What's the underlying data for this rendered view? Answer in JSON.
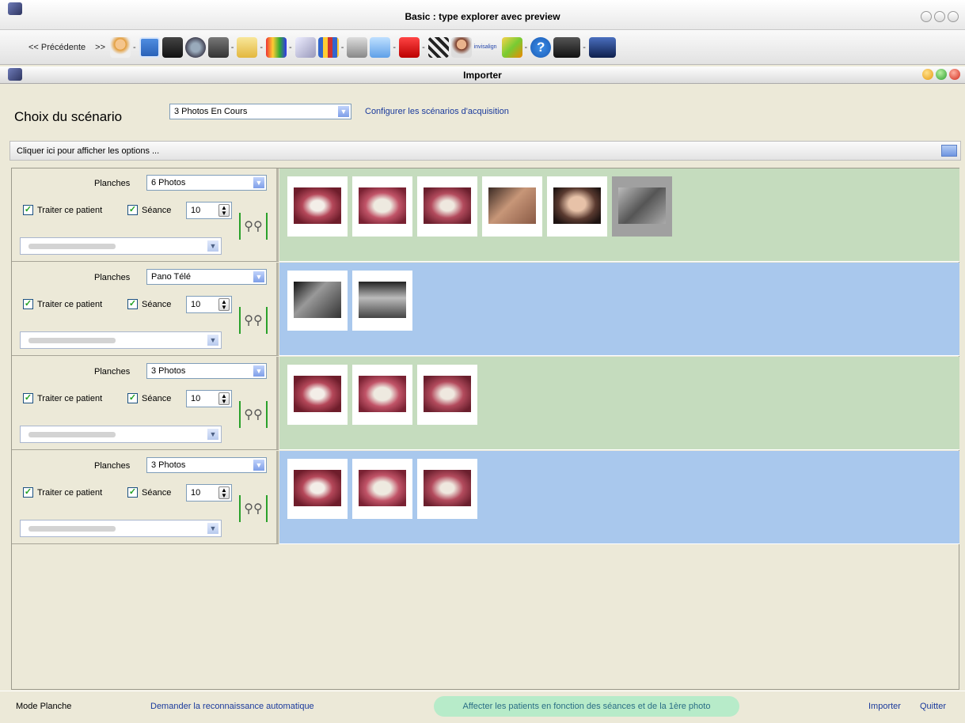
{
  "window": {
    "title": "Basic : type explorer avec preview"
  },
  "toolbar": {
    "prev_label": "<< Précédente",
    "more": ">>",
    "separator": "-",
    "icons": [
      "patient-icon",
      "window-icon",
      "scanner-icon",
      "camera-icon",
      "photo-camera-icon",
      "folder-icon",
      "paint-brushes-icon",
      "pencil-icon",
      "grid-icon",
      "printer-icon",
      "mail-icon",
      "presentation-icon",
      "clapperboard-icon",
      "person-icon",
      "invisalign-icon",
      "puzzle-icon",
      "help-icon",
      "dolphin-icon",
      "dolphin-blue-icon"
    ],
    "invisalign_text": "invisalign"
  },
  "subwindow": {
    "title": "Importer"
  },
  "scenario": {
    "label": "Choix du scénario",
    "selected": "3 Photos En Cours",
    "config_link": "Configurer les scénarios d'acquisition"
  },
  "options_bar": {
    "label": "Cliquer ici pour afficher les options ..."
  },
  "rows": [
    {
      "planches_label": "Planches",
      "planches": "6 Photos",
      "traiter_label": "Traiter ce patient",
      "seance_label": "Séance",
      "seance": "10",
      "traiter_checked": true,
      "seance_checked": true,
      "bg": "#c5dcbe",
      "photo_count": 6
    },
    {
      "planches_label": "Planches",
      "planches": "Pano Télé",
      "traiter_label": "Traiter ce patient",
      "seance_label": "Séance",
      "seance": "10",
      "traiter_checked": true,
      "seance_checked": true,
      "bg": "#a9c8ed",
      "photo_count": 2
    },
    {
      "planches_label": "Planches",
      "planches": "3 Photos",
      "traiter_label": "Traiter ce patient",
      "seance_label": "Séance",
      "seance": "10",
      "traiter_checked": true,
      "seance_checked": true,
      "bg": "#c5dcbe",
      "photo_count": 3
    },
    {
      "planches_label": "Planches",
      "planches": "3 Photos",
      "traiter_label": "Traiter ce patient",
      "seance_label": "Séance",
      "seance": "10",
      "traiter_checked": true,
      "seance_checked": true,
      "bg": "#a9c8ed",
      "photo_count": 3
    }
  ],
  "footer": {
    "mode": "Mode Planche",
    "auto_link": "Demander la reconnaissance automatique",
    "affect_button": "Affecter les patients en fonction des séances et de la 1ère photo",
    "import": "Importer",
    "quit": "Quitter"
  }
}
